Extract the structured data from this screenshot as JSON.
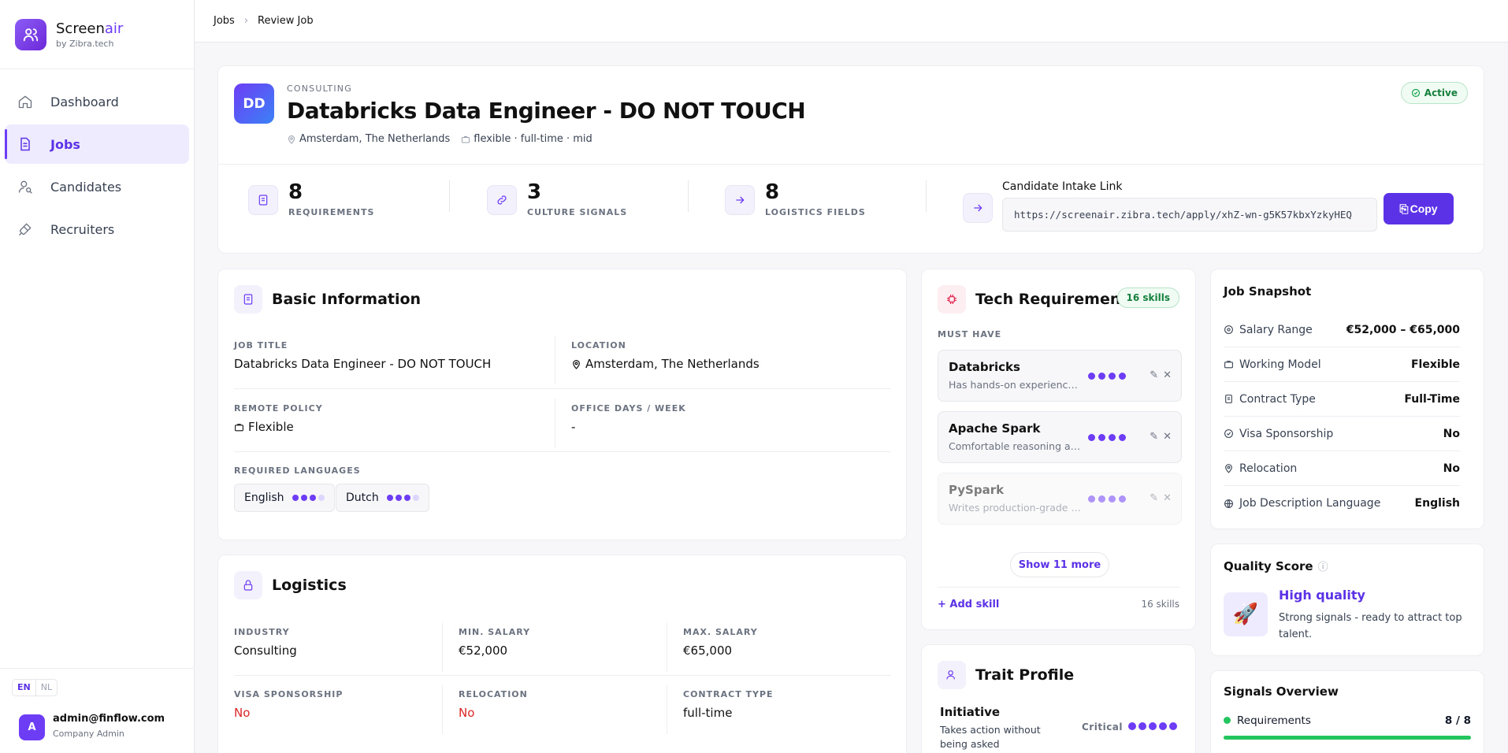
{
  "brand": {
    "name_prefix": "Screen",
    "name_suffix": "air",
    "sub": "by Zibra.tech"
  },
  "nav": {
    "items": [
      {
        "label": "Dashboard",
        "icon": "home-icon"
      },
      {
        "label": "Jobs",
        "icon": "document-icon",
        "active": true
      },
      {
        "label": "Candidates",
        "icon": "user-search-icon"
      },
      {
        "label": "Recruiters",
        "icon": "plug-icon"
      }
    ]
  },
  "lang": {
    "active": "EN",
    "other": "NL"
  },
  "user": {
    "avatar": "A",
    "email": "admin@finflow.com",
    "role": "Company Admin"
  },
  "breadcrumb": {
    "root": "Jobs",
    "current": "Review Job"
  },
  "job": {
    "avatar": "DD",
    "category": "CONSULTING",
    "title": "Databricks Data Engineer - DO NOT TOUCH",
    "location": "Amsterdam, The Netherlands",
    "terms": "flexible · full-time · mid",
    "status": "Active"
  },
  "stats": [
    {
      "value": "8",
      "label": "REQUIREMENTS",
      "icon": "list-icon"
    },
    {
      "value": "3",
      "label": "CULTURE SIGNALS",
      "icon": "link-icon"
    },
    {
      "value": "8",
      "label": "LOGISTICS FIELDS",
      "icon": "arrow-right-icon"
    }
  ],
  "intake": {
    "label": "Candidate Intake Link",
    "url": "https://screenair.zibra.tech/apply/xhZ-wn-g5K57kbxYzkyHEQ",
    "copy_label": "Copy"
  },
  "basic": {
    "title": "Basic Information",
    "job_title_label": "JOB TITLE",
    "job_title": "Databricks Data Engineer - DO NOT TOUCH",
    "location_label": "LOCATION",
    "location": "Amsterdam, The Netherlands",
    "remote_label": "REMOTE POLICY",
    "remote": "Flexible",
    "office_label": "OFFICE DAYS / WEEK",
    "office": "-",
    "languages_label": "REQUIRED LANGUAGES",
    "languages": [
      {
        "name": "English",
        "level": 3,
        "max": 4
      },
      {
        "name": "Dutch",
        "level": 3,
        "max": 4
      }
    ]
  },
  "logistics": {
    "title": "Logistics",
    "industry_label": "INDUSTRY",
    "industry": "Consulting",
    "min_label": "MIN. SALARY",
    "min": "€52,000",
    "max_label": "MAX. SALARY",
    "max": "€65,000",
    "visa_label": "VISA SPONSORSHIP",
    "visa": "No",
    "relocation_label": "RELOCATION",
    "relocation": "No",
    "contract_label": "CONTRACT TYPE",
    "contract": "full-time"
  },
  "tech": {
    "title": "Tech Requirements",
    "badge": "16 skills",
    "must_label": "MUST HAVE",
    "skills": [
      {
        "name": "Databricks",
        "desc": "Has hands-on experience with Databricks",
        "level": 4
      },
      {
        "name": "Apache Spark",
        "desc": "Comfortable reasoning about Spark jobs",
        "level": 4
      },
      {
        "name": "PySpark",
        "desc": "Writes production-grade PySpark code",
        "level": 4
      }
    ],
    "show_more": "Show 11 more",
    "add_skill": "+ Add skill",
    "count": "16 skills"
  },
  "trait": {
    "title": "Trait Profile",
    "name": "Initiative",
    "desc": "Takes action without being asked",
    "importance": "Critical",
    "level": 5
  },
  "snapshot": {
    "title": "Job Snapshot",
    "rows": [
      {
        "label": "Salary Range",
        "value": "€52,000 – €65,000",
        "icon": "coin-icon"
      },
      {
        "label": "Working Model",
        "value": "Flexible",
        "icon": "briefcase-icon"
      },
      {
        "label": "Contract Type",
        "value": "Full-Time",
        "icon": "document-icon"
      },
      {
        "label": "Visa Sponsorship",
        "value": "No",
        "icon": "check-circle-icon"
      },
      {
        "label": "Relocation",
        "value": "No",
        "icon": "pin-icon"
      },
      {
        "label": "Job Description Language",
        "value": "English",
        "icon": "globe-icon"
      }
    ]
  },
  "quality": {
    "title": "Quality Score",
    "label": "High quality",
    "desc": "Strong signals - ready to attract top talent.",
    "icon": "rocket-icon"
  },
  "signals": {
    "title": "Signals Overview",
    "rows": [
      {
        "label": "Requirements",
        "value": "8 / 8",
        "fill": 1.0
      }
    ]
  },
  "colors": {
    "accent": "#5b32e6",
    "success": "#22c55e",
    "danger": "#dc2626"
  }
}
